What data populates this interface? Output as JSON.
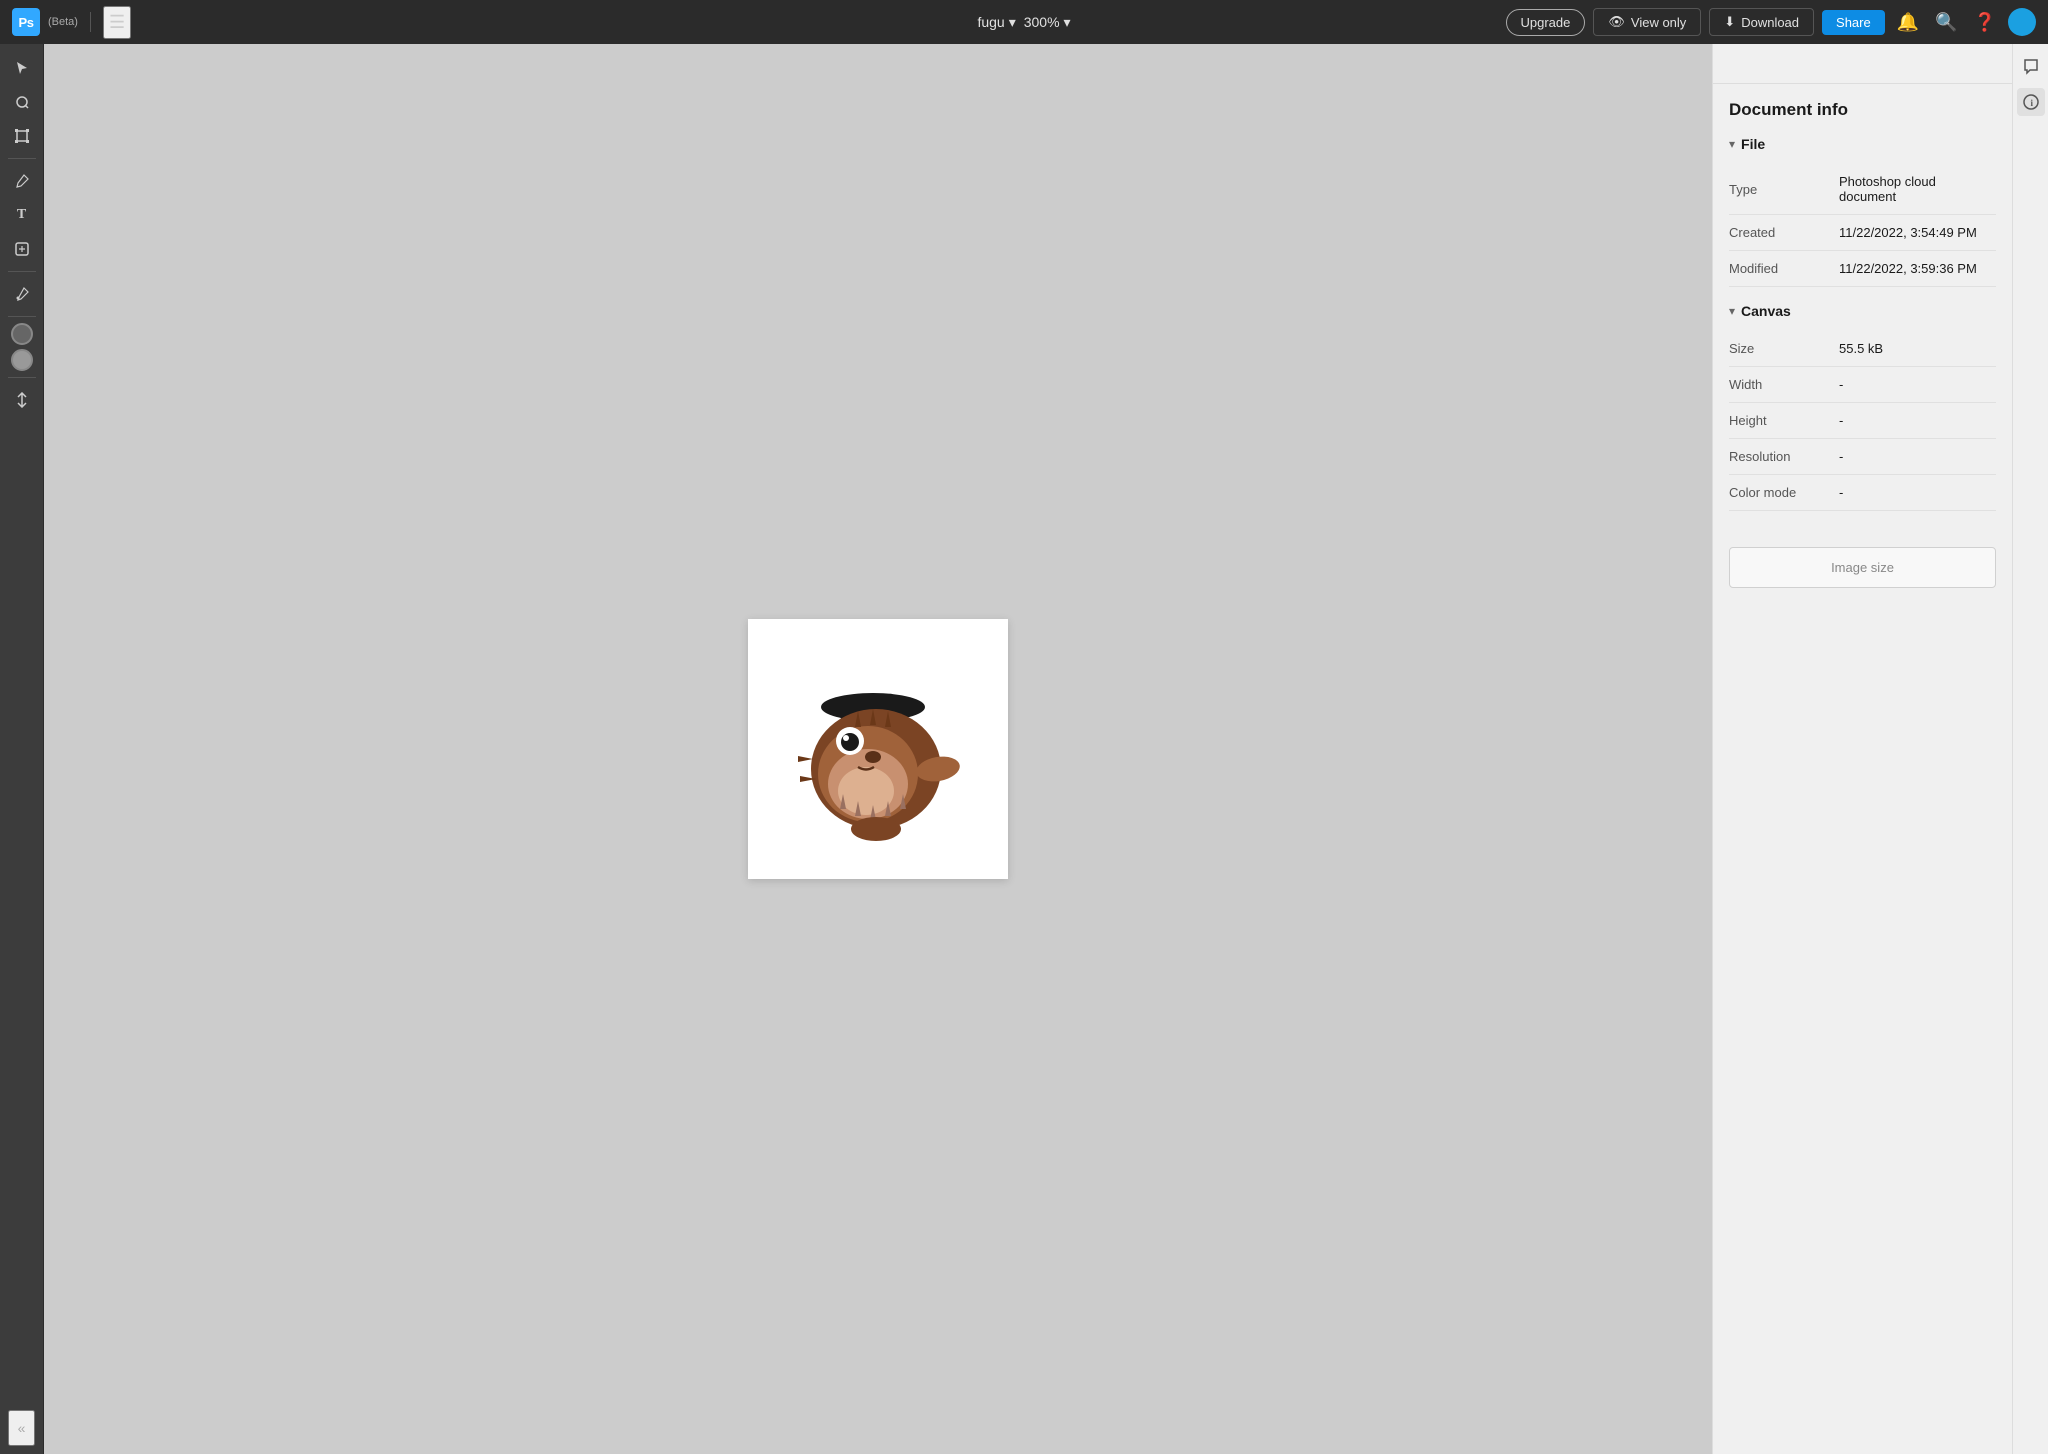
{
  "topbar": {
    "ps_label": "Ps",
    "beta_label": "(Beta)",
    "filename": "fugu",
    "zoom": "300%",
    "upgrade_label": "Upgrade",
    "view_only_label": "View only",
    "download_label": "Download",
    "share_label": "Share"
  },
  "toolbar": {
    "tools": [
      {
        "name": "select-tool",
        "icon": "↖",
        "label": "Select"
      },
      {
        "name": "lasso-tool",
        "icon": "⊖",
        "label": "Lasso"
      },
      {
        "name": "transform-tool",
        "icon": "⊞",
        "label": "Transform"
      },
      {
        "name": "brush-tool",
        "icon": "✏",
        "label": "Brush"
      },
      {
        "name": "type-tool",
        "icon": "T",
        "label": "Type"
      },
      {
        "name": "shape-tool",
        "icon": "❖",
        "label": "Shape"
      },
      {
        "name": "eyedropper-tool",
        "icon": "⊕",
        "label": "Eyedropper"
      },
      {
        "name": "swap-tool",
        "icon": "↕",
        "label": "Swap"
      }
    ]
  },
  "panel": {
    "title": "Document info",
    "sections": {
      "file": {
        "label": "File",
        "fields": {
          "type_label": "Type",
          "type_value": "Photoshop cloud document",
          "created_label": "Created",
          "created_value": "11/22/2022, 3:54:49 PM",
          "modified_label": "Modified",
          "modified_value": "11/22/2022, 3:59:36 PM"
        }
      },
      "canvas": {
        "label": "Canvas",
        "fields": {
          "size_label": "Size",
          "size_value": "55.5 kB",
          "width_label": "Width",
          "width_value": "-",
          "height_label": "Height",
          "height_value": "-",
          "resolution_label": "Resolution",
          "resolution_value": "-",
          "color_mode_label": "Color mode",
          "color_mode_value": "-"
        }
      }
    },
    "image_size_button": "Image size"
  }
}
